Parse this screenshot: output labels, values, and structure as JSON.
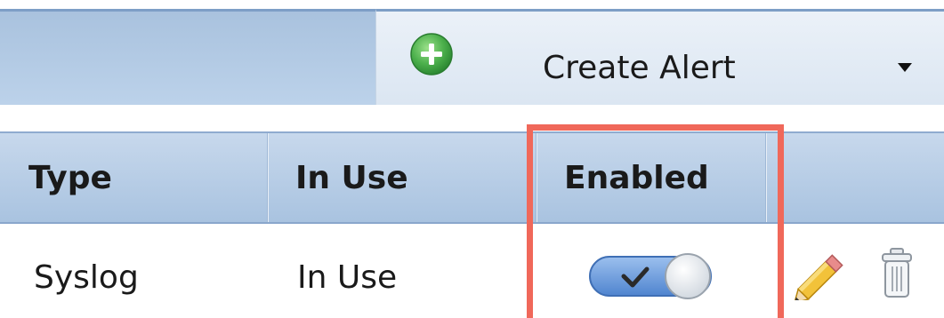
{
  "toolbar": {
    "create_label": "Create Alert",
    "plus_icon": "plus-circle-icon",
    "caret_icon": "caret-down-icon"
  },
  "table": {
    "columns": [
      "Type",
      "In Use",
      "Enabled"
    ],
    "rows": [
      {
        "type": "Syslog",
        "in_use": "In Use",
        "enabled": true,
        "actions": [
          "pencil-icon",
          "trash-icon"
        ]
      }
    ]
  },
  "highlight": {
    "target": "Enabled",
    "color": "#f0685a"
  },
  "colors": {
    "header_bg": "#b6cce6",
    "toggle_on": "#5b8fd6",
    "plus_icon": "#4cb04c"
  }
}
